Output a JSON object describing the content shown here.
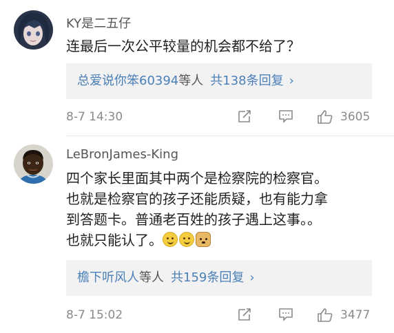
{
  "comments": [
    {
      "username": "KY是二五仔",
      "content_lines": [
        "连最后一次公平较量的机会都不给了？"
      ],
      "reply": {
        "users": "总爱说你笨60394",
        "users_suffix": "等人",
        "count": "共138条回复",
        "arrow": "›"
      },
      "timestamp": "8-7 14:30",
      "likes": "3605"
    },
    {
      "username": "LeBronJames-King",
      "content_lines": [
        "四个家长里面其中两个是检察院的检察官。",
        "也就是检察官的孩子还能质疑，也有能力拿",
        "到答题卡。普通老百姓的孩子遇上这事。。",
        "也就只能认了。"
      ],
      "emojis": [
        "smile-emoji",
        "smile-emoji",
        "doge-emoji"
      ],
      "reply": {
        "users": "檐下听风人",
        "users_suffix": "等人",
        "count": "共159条回复",
        "arrow": "›"
      },
      "timestamp": "8-7 15:02",
      "likes": "3477"
    }
  ],
  "icons": {
    "repost": "repost-icon",
    "comment": "comment-icon",
    "like": "thumbs-up-icon"
  },
  "colors": {
    "link": "#4a7fb8",
    "meta": "#8a8a8a",
    "reply_bg": "#f2f2f2"
  }
}
